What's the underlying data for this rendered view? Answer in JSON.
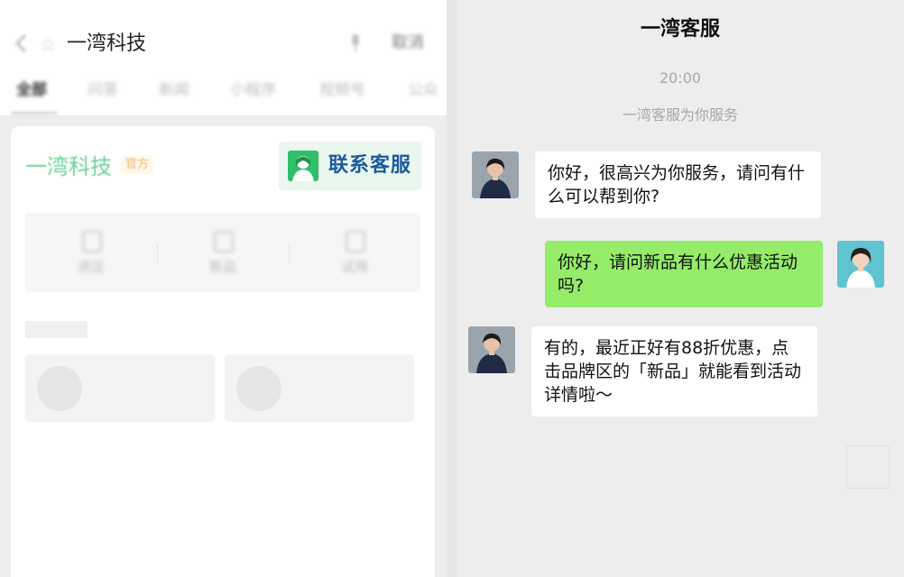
{
  "search_page": {
    "title": "一湾科技",
    "cancel_label": "取消",
    "tabs": [
      {
        "label": "全部",
        "active": true
      },
      {
        "label": "问答",
        "active": false
      },
      {
        "label": "新闻",
        "active": false
      },
      {
        "label": "小程序",
        "active": false
      },
      {
        "label": "视频号",
        "active": false
      },
      {
        "label": "公众",
        "active": false
      }
    ],
    "account": {
      "name": "一湾科技",
      "badge": "官方",
      "contact_button": "联系客服",
      "quick_actions": [
        {
          "label": "进店",
          "icon": "store-icon"
        },
        {
          "label": "新品",
          "icon": "gift-icon"
        },
        {
          "label": "试用",
          "icon": "trial-icon"
        }
      ]
    }
  },
  "chat": {
    "title": "一湾客服",
    "time": "20:00",
    "system_notice": "一湾客服为你服务",
    "messages": [
      {
        "from": "agent",
        "text": "你好，很高兴为你服务，请问有什么可以帮到你?"
      },
      {
        "from": "user",
        "text": "你好，请问新品有什么优惠活动吗?"
      },
      {
        "from": "agent",
        "text": "有的，最近正好有88折优惠，点击品牌区的「新品」就能看到活动详情啦～"
      }
    ]
  },
  "colors": {
    "brand_green": "#6dd298",
    "contact_text": "#1d5a9e",
    "user_bubble": "#95ec69",
    "agent_bubble": "#ffffff",
    "chat_bg": "#ededed"
  }
}
